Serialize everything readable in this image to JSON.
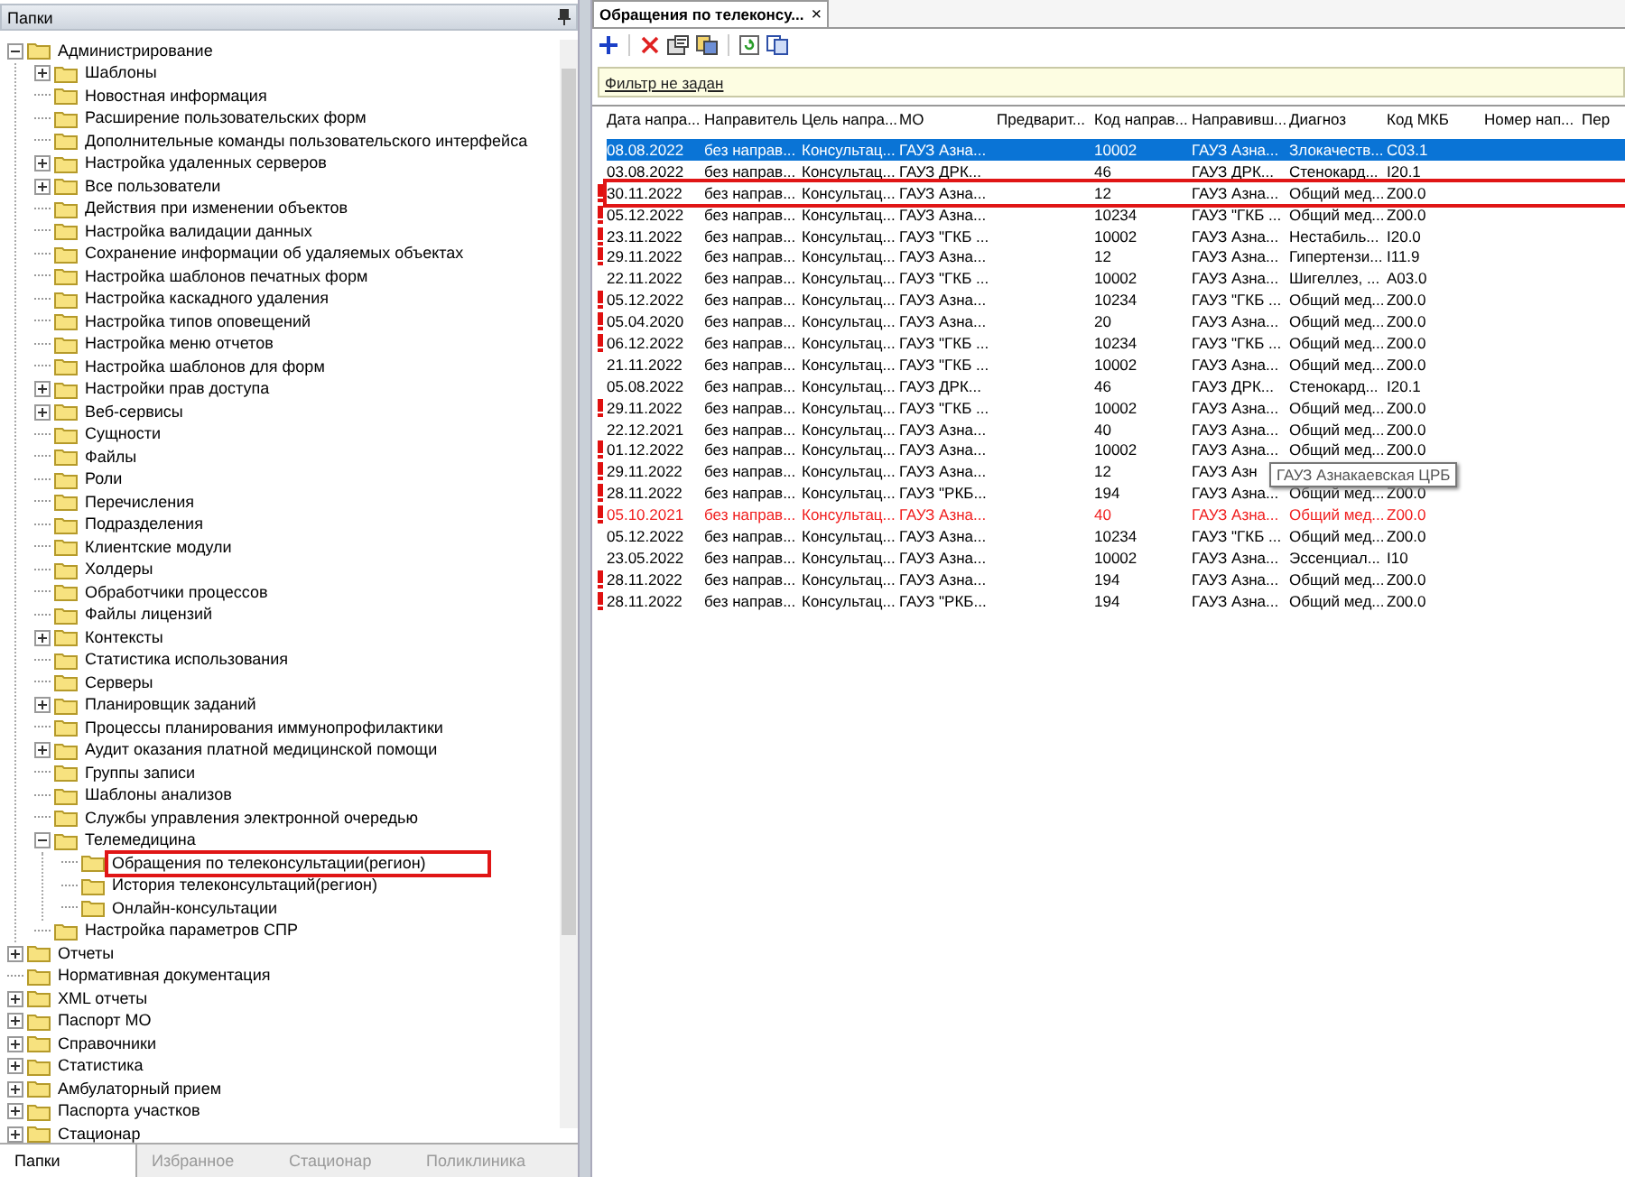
{
  "folders_panel": {
    "title": "Папки",
    "tree": [
      {
        "label": "Администрирование",
        "kind": "branch",
        "expanded": true,
        "children": [
          {
            "label": "Шаблоны",
            "kind": "branch",
            "expanded": false
          },
          {
            "label": "Новостная информация",
            "kind": "leaf"
          },
          {
            "label": "Расширение пользовательских форм",
            "kind": "leaf"
          },
          {
            "label": "Дополнительные команды пользовательского интерфейса",
            "kind": "leaf"
          },
          {
            "label": "Настройка удаленных серверов",
            "kind": "branch",
            "expanded": false
          },
          {
            "label": "Все пользователи",
            "kind": "branch",
            "expanded": false
          },
          {
            "label": "Действия при изменении объектов",
            "kind": "leaf"
          },
          {
            "label": "Настройка валидации данных",
            "kind": "leaf"
          },
          {
            "label": "Сохранение информации об удаляемых объектах",
            "kind": "leaf"
          },
          {
            "label": "Настройка шаблонов печатных форм",
            "kind": "leaf"
          },
          {
            "label": "Настройка каскадного удаления",
            "kind": "leaf"
          },
          {
            "label": "Настройка типов оповещений",
            "kind": "leaf"
          },
          {
            "label": "Настройка меню отчетов",
            "kind": "leaf"
          },
          {
            "label": "Настройка шаблонов для форм",
            "kind": "leaf"
          },
          {
            "label": "Настройки прав доступа",
            "kind": "branch",
            "expanded": false
          },
          {
            "label": "Веб-сервисы",
            "kind": "branch",
            "expanded": false
          },
          {
            "label": "Сущности",
            "kind": "leaf"
          },
          {
            "label": "Файлы",
            "kind": "leaf"
          },
          {
            "label": "Роли",
            "kind": "leaf"
          },
          {
            "label": "Перечисления",
            "kind": "leaf"
          },
          {
            "label": "Подразделения",
            "kind": "leaf"
          },
          {
            "label": "Клиентские модули",
            "kind": "leaf"
          },
          {
            "label": "Холдеры",
            "kind": "leaf"
          },
          {
            "label": "Обработчики процессов",
            "kind": "leaf"
          },
          {
            "label": "Файлы лицензий",
            "kind": "leaf"
          },
          {
            "label": "Контексты",
            "kind": "branch",
            "expanded": false
          },
          {
            "label": "Статистика использования",
            "kind": "leaf"
          },
          {
            "label": "Серверы",
            "kind": "leaf"
          },
          {
            "label": "Планировщик заданий",
            "kind": "branch",
            "expanded": false
          },
          {
            "label": "Процессы планирования иммунопрофилактики",
            "kind": "leaf"
          },
          {
            "label": "Аудит оказания платной медицинской помощи",
            "kind": "branch",
            "expanded": false
          },
          {
            "label": "Группы записи",
            "kind": "leaf"
          },
          {
            "label": "Шаблоны анализов",
            "kind": "leaf"
          },
          {
            "label": "Службы управления электронной очередью",
            "kind": "leaf"
          },
          {
            "label": "Телемедицина",
            "kind": "branch",
            "expanded": true,
            "children": [
              {
                "label": "Обращения по телеконсультации(регион)",
                "kind": "leaf",
                "outlined": true
              },
              {
                "label": "История телеконсультаций(регион)",
                "kind": "leaf",
                "outlined": false
              },
              {
                "label": "Онлайн-консультации",
                "kind": "leaf",
                "outlined": false
              }
            ]
          },
          {
            "label": "Настройка параметров СПР",
            "kind": "leaf"
          }
        ]
      },
      {
        "label": "Отчеты",
        "kind": "branch",
        "expanded": false
      },
      {
        "label": "Нормативная документация",
        "kind": "leaf"
      },
      {
        "label": "XML отчеты",
        "kind": "branch",
        "expanded": false
      },
      {
        "label": "Паспорт МО",
        "kind": "branch",
        "expanded": false
      },
      {
        "label": "Справочники",
        "kind": "branch",
        "expanded": false
      },
      {
        "label": "Статистика",
        "kind": "branch",
        "expanded": false
      },
      {
        "label": "Амбулаторный прием",
        "kind": "branch",
        "expanded": false
      },
      {
        "label": "Паспорта участков",
        "kind": "branch",
        "expanded": false
      },
      {
        "label": "Стационар",
        "kind": "branch",
        "expanded": false
      }
    ],
    "bottom_tabs": [
      {
        "label": "Папки",
        "selected": true
      },
      {
        "label": "Избранное",
        "selected": false
      },
      {
        "label": "Стационар",
        "selected": false
      },
      {
        "label": "Поликлиника",
        "selected": false
      }
    ]
  },
  "document_tab": {
    "title": "Обращения по телеконсу...",
    "close": "×"
  },
  "filter": {
    "link": "Фильтр не задан"
  },
  "table": {
    "columns": [
      "Дата напра...",
      "Направитель",
      "Цель напра...",
      "МО",
      "Предварит...",
      "Код направ...",
      "Направивш...",
      "Диагноз",
      "Код МКБ",
      "Номер нап...",
      "Пер"
    ],
    "rows": [
      {
        "selected": true,
        "alert": false,
        "red": false,
        "outlined": false,
        "date": "08.08.2022",
        "referrer": "без направ...",
        "purpose": "Консультац...",
        "mo": "ГАУЗ Азна...",
        "referral_code": "10002",
        "referring_org": "ГАУЗ Азна...",
        "diagnosis": "Злокачеств...",
        "icd_code": "C03.1"
      },
      {
        "selected": false,
        "alert": false,
        "red": false,
        "outlined": false,
        "date": "03.08.2022",
        "referrer": "без направ...",
        "purpose": "Консультац...",
        "mo": "ГАУЗ ДРК...",
        "referral_code": "46",
        "referring_org": "ГАУЗ ДРК...",
        "diagnosis": "Стенокард...",
        "icd_code": "I20.1"
      },
      {
        "selected": false,
        "alert": true,
        "red": false,
        "outlined": true,
        "date": "30.11.2022",
        "referrer": "без направ...",
        "purpose": "Консультац...",
        "mo": "ГАУЗ Азна...",
        "referral_code": "12",
        "referring_org": "ГАУЗ Азна...",
        "diagnosis": "Общий мед...",
        "icd_code": "Z00.0"
      },
      {
        "selected": false,
        "alert": true,
        "red": false,
        "outlined": false,
        "date": "05.12.2022",
        "referrer": "без направ...",
        "purpose": "Консультац...",
        "mo": "ГАУЗ Азна...",
        "referral_code": "10234",
        "referring_org": "ГАУЗ \"ГКБ ...",
        "diagnosis": "Общий мед...",
        "icd_code": "Z00.0"
      },
      {
        "selected": false,
        "alert": true,
        "red": false,
        "outlined": false,
        "date": "23.11.2022",
        "referrer": "без направ...",
        "purpose": "Консультац...",
        "mo": "ГАУЗ \"ГКБ ...",
        "referral_code": "10002",
        "referring_org": "ГАУЗ Азна...",
        "diagnosis": "Нестабиль...",
        "icd_code": "I20.0"
      },
      {
        "selected": false,
        "alert": true,
        "red": false,
        "outlined": false,
        "date": "29.11.2022",
        "referrer": "без направ...",
        "purpose": "Консультац...",
        "mo": "ГАУЗ Азна...",
        "referral_code": "12",
        "referring_org": "ГАУЗ Азна...",
        "diagnosis": "Гипертензи...",
        "icd_code": "I11.9"
      },
      {
        "selected": false,
        "alert": false,
        "red": false,
        "outlined": false,
        "date": "22.11.2022",
        "referrer": "без направ...",
        "purpose": "Консультац...",
        "mo": "ГАУЗ \"ГКБ ...",
        "referral_code": "10002",
        "referring_org": "ГАУЗ Азна...",
        "diagnosis": "Шигеллез, ...",
        "icd_code": "A03.0"
      },
      {
        "selected": false,
        "alert": true,
        "red": false,
        "outlined": false,
        "date": "05.12.2022",
        "referrer": "без направ...",
        "purpose": "Консультац...",
        "mo": "ГАУЗ Азна...",
        "referral_code": "10234",
        "referring_org": "ГАУЗ \"ГКБ ...",
        "diagnosis": "Общий мед...",
        "icd_code": "Z00.0"
      },
      {
        "selected": false,
        "alert": true,
        "red": false,
        "outlined": false,
        "date": "05.04.2020",
        "referrer": "без направ...",
        "purpose": "Консультац...",
        "mo": "ГАУЗ Азна...",
        "referral_code": "20",
        "referring_org": "ГАУЗ Азна...",
        "diagnosis": "Общий мед...",
        "icd_code": "Z00.0"
      },
      {
        "selected": false,
        "alert": true,
        "red": false,
        "outlined": false,
        "date": "06.12.2022",
        "referrer": "без направ...",
        "purpose": "Консультац...",
        "mo": "ГАУЗ \"ГКБ ...",
        "referral_code": "10234",
        "referring_org": "ГАУЗ \"ГКБ ...",
        "diagnosis": "Общий мед...",
        "icd_code": "Z00.0"
      },
      {
        "selected": false,
        "alert": false,
        "red": false,
        "outlined": false,
        "date": "21.11.2022",
        "referrer": "без направ...",
        "purpose": "Консультац...",
        "mo": "ГАУЗ \"ГКБ ...",
        "referral_code": "10002",
        "referring_org": "ГАУЗ Азна...",
        "diagnosis": "Общий мед...",
        "icd_code": "Z00.0"
      },
      {
        "selected": false,
        "alert": false,
        "red": false,
        "outlined": false,
        "date": "05.08.2022",
        "referrer": "без направ...",
        "purpose": "Консультац...",
        "mo": "ГАУЗ ДРК...",
        "referral_code": "46",
        "referring_org": "ГАУЗ ДРК...",
        "diagnosis": "Стенокард...",
        "icd_code": "I20.1"
      },
      {
        "selected": false,
        "alert": true,
        "red": false,
        "outlined": false,
        "date": "29.11.2022",
        "referrer": "без направ...",
        "purpose": "Консультац...",
        "mo": "ГАУЗ \"ГКБ ...",
        "referral_code": "10002",
        "referring_org": "ГАУЗ Азна...",
        "diagnosis": "Общий мед...",
        "icd_code": "Z00.0"
      },
      {
        "selected": false,
        "alert": false,
        "red": false,
        "outlined": false,
        "date": "22.12.2021",
        "referrer": "без направ...",
        "purpose": "Консультац...",
        "mo": "ГАУЗ Азна...",
        "referral_code": "40",
        "referring_org": "ГАУЗ Азна...",
        "diagnosis": "Общий мед...",
        "icd_code": "Z00.0"
      },
      {
        "selected": false,
        "alert": true,
        "red": false,
        "outlined": false,
        "date": "01.12.2022",
        "referrer": "без направ...",
        "purpose": "Консультац...",
        "mo": "ГАУЗ Азна...",
        "referral_code": "10002",
        "referring_org": "ГАУЗ Азна...",
        "diagnosis": "Общий мед...",
        "icd_code": "Z00.0"
      },
      {
        "selected": false,
        "alert": true,
        "red": false,
        "outlined": false,
        "date": "29.11.2022",
        "referrer": "без направ...",
        "purpose": "Консультац...",
        "mo": "ГАУЗ Азна...",
        "referral_code": "12",
        "referring_org": "ГАУЗ Азн"
      },
      {
        "selected": false,
        "alert": true,
        "red": false,
        "outlined": false,
        "date": "28.11.2022",
        "referrer": "без направ...",
        "purpose": "Консультац...",
        "mo": "ГАУЗ \"РКБ...",
        "referral_code": "194",
        "referring_org": "ГАУЗ Азна...",
        "diagnosis": "Общий мед...",
        "icd_code": "Z00.0"
      },
      {
        "selected": false,
        "alert": true,
        "red": true,
        "outlined": false,
        "date": "05.10.2021",
        "referrer": "без направ...",
        "purpose": "Консультац...",
        "mo": "ГАУЗ Азна...",
        "referral_code": "40",
        "referring_org": "ГАУЗ Азна...",
        "diagnosis": "Общий мед...",
        "icd_code": "Z00.0"
      },
      {
        "selected": false,
        "alert": false,
        "red": false,
        "outlined": false,
        "date": "05.12.2022",
        "referrer": "без направ...",
        "purpose": "Консультац...",
        "mo": "ГАУЗ Азна...",
        "referral_code": "10234",
        "referring_org": "ГАУЗ \"ГКБ ...",
        "diagnosis": "Общий мед...",
        "icd_code": "Z00.0"
      },
      {
        "selected": false,
        "alert": false,
        "red": false,
        "outlined": false,
        "date": "23.05.2022",
        "referrer": "без направ...",
        "purpose": "Консультац...",
        "mo": "ГАУЗ Азна...",
        "referral_code": "10002",
        "referring_org": "ГАУЗ Азна...",
        "diagnosis": "Эссенциал...",
        "icd_code": "I10"
      },
      {
        "selected": false,
        "alert": true,
        "red": false,
        "outlined": false,
        "date": "28.11.2022",
        "referrer": "без направ...",
        "purpose": "Консультац...",
        "mo": "ГАУЗ Азна...",
        "referral_code": "194",
        "referring_org": "ГАУЗ Азна...",
        "diagnosis": "Общий мед...",
        "icd_code": "Z00.0"
      },
      {
        "selected": false,
        "alert": true,
        "red": false,
        "outlined": false,
        "date": "28.11.2022",
        "referrer": "без направ...",
        "purpose": "Консультац...",
        "mo": "ГАУЗ \"РКБ...",
        "referral_code": "194",
        "referring_org": "ГАУЗ Азна...",
        "diagnosis": "Общий мед...",
        "icd_code": "Z00.0"
      }
    ]
  },
  "tooltip": "ГАУЗ Азнакаевская ЦРБ"
}
